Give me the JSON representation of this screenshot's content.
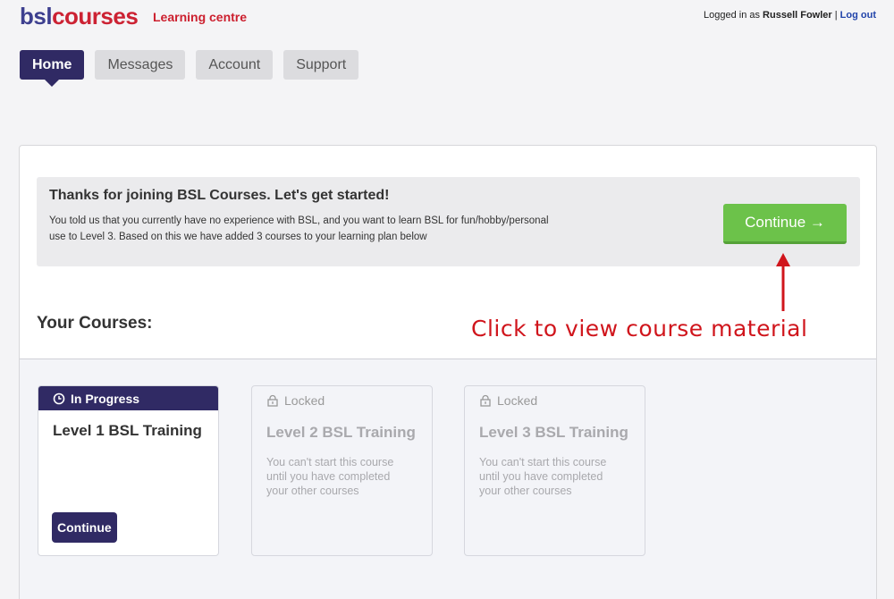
{
  "header": {
    "logo_part1": "bsl",
    "logo_part2": "courses",
    "tagline": "Learning centre",
    "logged_in_prefix": "Logged in as",
    "user_name": "Russell Fowler",
    "separator": "|",
    "logout_label": "Log out"
  },
  "tabs": [
    {
      "label": "Home",
      "active": true
    },
    {
      "label": "Messages",
      "active": false
    },
    {
      "label": "Account",
      "active": false
    },
    {
      "label": "Support",
      "active": false
    }
  ],
  "welcome": {
    "title": "Thanks for joining BSL Courses. Let's get started!",
    "text": "You told us that you currently have no experience with BSL, and you want to learn BSL for fun/hobby/personal use to Level 3. Based on this we have added 3 courses to your learning plan below",
    "continue_label": "Continue →"
  },
  "annotation": "Click to view course material",
  "section_title": "Your Courses:",
  "courses": [
    {
      "status": "In Progress",
      "status_icon": "clock-icon",
      "title": "Level 1 BSL Training",
      "button_label": "Continue"
    },
    {
      "status": "Locked",
      "status_icon": "lock-icon",
      "title": "Level 2 BSL Training",
      "description": "You can't start this course until you have completed your other courses"
    },
    {
      "status": "Locked",
      "status_icon": "lock-icon",
      "title": "Level 3 BSL Training",
      "description": "You can't start this course until you have completed your other courses"
    }
  ],
  "colors": {
    "brand_navy": "#302a64",
    "brand_red": "#cc1f2e",
    "continue_green": "#6cc24a",
    "annotation_red": "#d0151c"
  }
}
